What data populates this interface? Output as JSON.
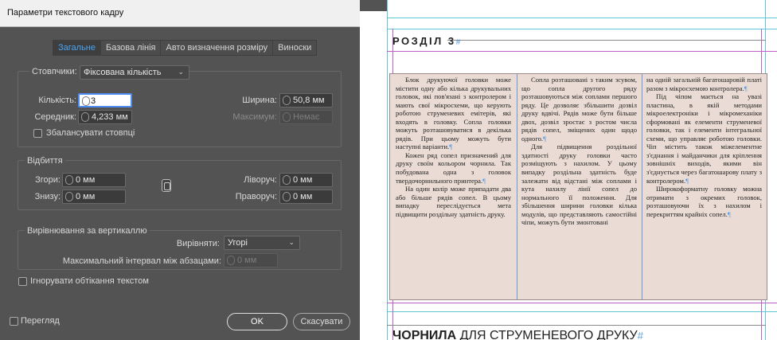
{
  "dialog": {
    "title": "Параметри текстового кадру",
    "tabs": [
      "Загальне",
      "Базова лінія",
      "Авто визначення розміру",
      "Виноски"
    ],
    "columns": {
      "group_label": "Стовпчики:",
      "type_value": "Фіксована кількість",
      "count_label": "Кількість:",
      "count_value": "3",
      "gutter_label": "Середник:",
      "gutter_value": "4,233 мм",
      "width_label": "Ширина:",
      "width_value": "50,8 мм",
      "max_label": "Максимум:",
      "max_value": "Немає",
      "balance_label": "Збалансувати стовпці"
    },
    "inset": {
      "title": "Відбиття",
      "top_label": "Згори:",
      "top_value": "0 мм",
      "bottom_label": "Знизу:",
      "bottom_value": "0 мм",
      "left_label": "Ліворуч:",
      "left_value": "0 мм",
      "right_label": "Праворуч:",
      "right_value": "0 мм"
    },
    "vjust": {
      "title": "Вирівнювання за вертикаллю",
      "align_label": "Вирівняти:",
      "align_value": "Угорі",
      "spacing_label": "Максимальний інтервал між абзацами:",
      "spacing_value": "0 мм"
    },
    "ignore_wrap_label": "Ігнорувати обтікання текстом",
    "preview_label": "Перегляд",
    "ok_label": "OK",
    "cancel_label": "Скасувати"
  },
  "document": {
    "section_label": "РОЗДІЛ 3",
    "section_mark": "#",
    "pilcrow": "¶",
    "heading_bold": "ЧОРНИЛА",
    "heading_rest": " ДЛЯ СТРУМЕНЕВОГО ДРУКУ",
    "heading_mark": "#",
    "columns": [
      {
        "paragraphs": [
          {
            "text": "Блок друкуючої головки може містити одну або кількa друкувальних головок, які пов'язані з контролером і мають свої мікросхеми, що керують роботою струменевих емітерів, які входять в головку. Сопла головки можуть розташовуватися в декілька рядів. При цьому можуть бути наступні варіанти.",
            "mark": "¶"
          },
          {
            "text": "Кожен ряд сопел призначений для друку своїм кольором чорнила. Так побудована одна з головок твердочорнильного принтера.",
            "mark": "¶"
          },
          {
            "text": "На один колір може припадати два або більше рядів сопел. В цьому випадку переслідується мета підвищити роздільну здатність друку.",
            "mark": ""
          }
        ]
      },
      {
        "paragraphs": [
          {
            "text": "Сопла розташовані з таким зсувом, що сопла другого ряду розташовуються між соплами першого ряду. Це дозволяє збільшити дозвіл друку вдвічі. Рядів може бути більше двох, дозвіл зростає з ростом числа рядів сопел, зміщених один щодо одного.",
            "mark": "¶"
          },
          {
            "text": "Для підвищення роздільної здатності друку головки часто розміщують з нахилом. У цьому випадку роздільна здатність буде залежати від відстані між соплами і кута нахилу лінії сопел до нормального її положення. Для збільшення ширини головки кілька модулів, що представляють самостійні чіпи, можуть бути змонтовані",
            "mark": ""
          }
        ]
      },
      {
        "paragraphs": [
          {
            "text": "на одній загальній багатошаровій платі разом з мікросхемою контролера.",
            "mark": "¶",
            "noindent": true
          },
          {
            "text": "Під чіпом мається на увазі пластина, в якій методами мікроелектроніки і мікромеханіки сформовані як елементи струменевої головки, так і елементи інтегральної схеми, що управляє роботою головки. Чіп містить також міжелементне з'єднання і майданчики для кріплення зовнішніх виходів, якими він з'єднується через багатошарову плату з контролером.",
            "mark": "¶"
          },
          {
            "text": "Широкоформатну головку можна отримати з окремих головок, розташовуючи їх з нахилом і перекриттям крайніх сопел.",
            "mark": "¶"
          }
        ]
      }
    ]
  }
}
